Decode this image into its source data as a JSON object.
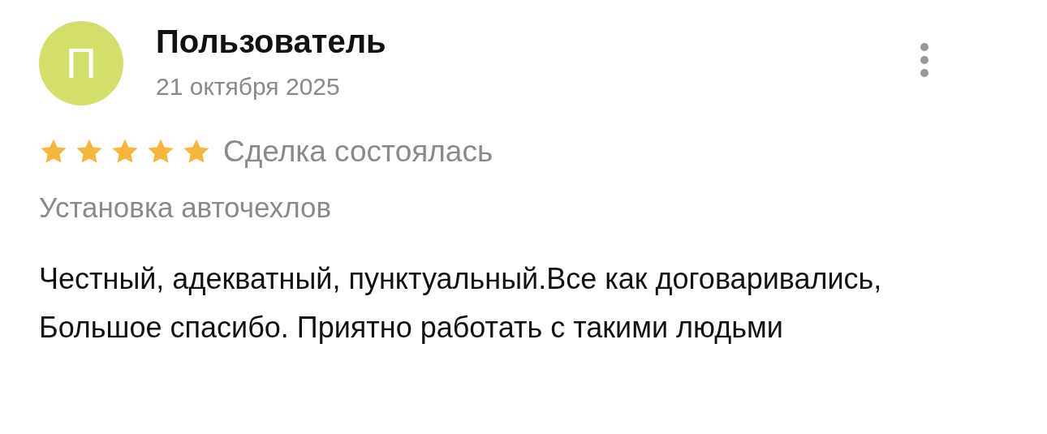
{
  "review": {
    "avatar_letter": "П",
    "author": "Пользователь",
    "date": "21 октября 2025",
    "stars": 5,
    "deal_status": "Сделка состоялась",
    "service": "Установка авточехлов",
    "text": "Честный, адекватный, пунктуальный.Все как договаривались, Большое спасибо. Приятно работать с такими людьми"
  }
}
